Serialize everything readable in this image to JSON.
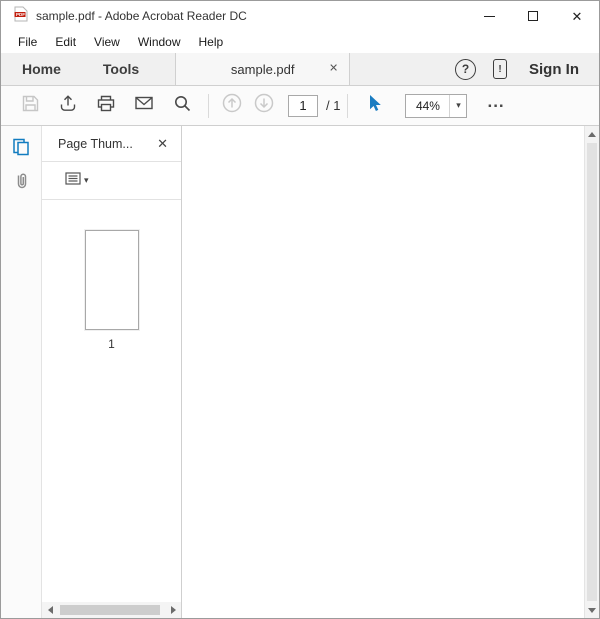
{
  "window": {
    "title": "sample.pdf - Adobe Acrobat Reader DC"
  },
  "menubar": {
    "items": [
      {
        "label": "File"
      },
      {
        "label": "Edit"
      },
      {
        "label": "View"
      },
      {
        "label": "Window"
      },
      {
        "label": "Help"
      }
    ]
  },
  "tabbar": {
    "home": "Home",
    "tools": "Tools",
    "document_tab": "sample.pdf",
    "sign_in": "Sign In"
  },
  "toolbar": {
    "page_current": "1",
    "page_total": "/ 1",
    "zoom_value": "44%"
  },
  "sidebar": {
    "panel_title": "Page Thum...",
    "thumb_page_label": "1"
  },
  "icons": {
    "close": "✕",
    "caret_down": "▾",
    "help": "?",
    "exclamation": "!",
    "more": "..."
  },
  "colors": {
    "accent_blue": "#127cc0",
    "pdf_icon_red": "#c11e0e",
    "toolbar_bg": "#fbfbfb",
    "tabbar_bg": "#f0f0f0"
  }
}
